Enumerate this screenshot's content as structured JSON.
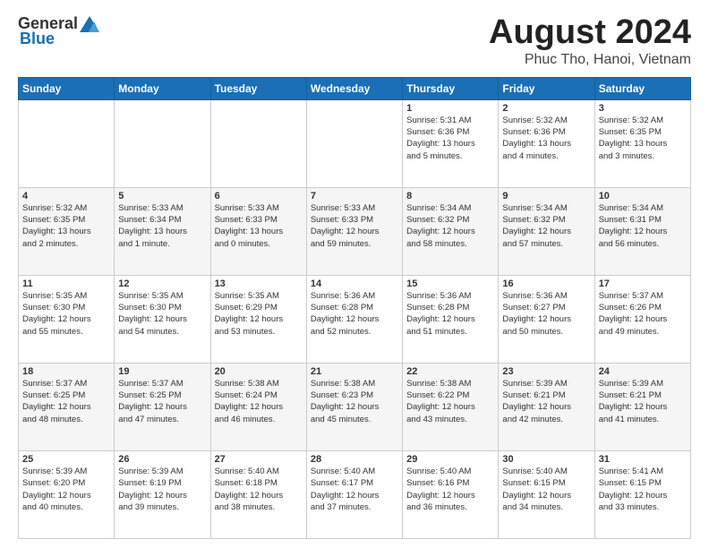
{
  "logo": {
    "general": "General",
    "blue": "Blue"
  },
  "title": {
    "main": "August 2024",
    "sub": "Phuc Tho, Hanoi, Vietnam"
  },
  "headers": [
    "Sunday",
    "Monday",
    "Tuesday",
    "Wednesday",
    "Thursday",
    "Friday",
    "Saturday"
  ],
  "weeks": [
    [
      {
        "day": "",
        "info": ""
      },
      {
        "day": "",
        "info": ""
      },
      {
        "day": "",
        "info": ""
      },
      {
        "day": "",
        "info": ""
      },
      {
        "day": "1",
        "info": "Sunrise: 5:31 AM\nSunset: 6:36 PM\nDaylight: 13 hours\nand 5 minutes."
      },
      {
        "day": "2",
        "info": "Sunrise: 5:32 AM\nSunset: 6:36 PM\nDaylight: 13 hours\nand 4 minutes."
      },
      {
        "day": "3",
        "info": "Sunrise: 5:32 AM\nSunset: 6:35 PM\nDaylight: 13 hours\nand 3 minutes."
      }
    ],
    [
      {
        "day": "4",
        "info": "Sunrise: 5:32 AM\nSunset: 6:35 PM\nDaylight: 13 hours\nand 2 minutes."
      },
      {
        "day": "5",
        "info": "Sunrise: 5:33 AM\nSunset: 6:34 PM\nDaylight: 13 hours\nand 1 minute."
      },
      {
        "day": "6",
        "info": "Sunrise: 5:33 AM\nSunset: 6:33 PM\nDaylight: 13 hours\nand 0 minutes."
      },
      {
        "day": "7",
        "info": "Sunrise: 5:33 AM\nSunset: 6:33 PM\nDaylight: 12 hours\nand 59 minutes."
      },
      {
        "day": "8",
        "info": "Sunrise: 5:34 AM\nSunset: 6:32 PM\nDaylight: 12 hours\nand 58 minutes."
      },
      {
        "day": "9",
        "info": "Sunrise: 5:34 AM\nSunset: 6:32 PM\nDaylight: 12 hours\nand 57 minutes."
      },
      {
        "day": "10",
        "info": "Sunrise: 5:34 AM\nSunset: 6:31 PM\nDaylight: 12 hours\nand 56 minutes."
      }
    ],
    [
      {
        "day": "11",
        "info": "Sunrise: 5:35 AM\nSunset: 6:30 PM\nDaylight: 12 hours\nand 55 minutes."
      },
      {
        "day": "12",
        "info": "Sunrise: 5:35 AM\nSunset: 6:30 PM\nDaylight: 12 hours\nand 54 minutes."
      },
      {
        "day": "13",
        "info": "Sunrise: 5:35 AM\nSunset: 6:29 PM\nDaylight: 12 hours\nand 53 minutes."
      },
      {
        "day": "14",
        "info": "Sunrise: 5:36 AM\nSunset: 6:28 PM\nDaylight: 12 hours\nand 52 minutes."
      },
      {
        "day": "15",
        "info": "Sunrise: 5:36 AM\nSunset: 6:28 PM\nDaylight: 12 hours\nand 51 minutes."
      },
      {
        "day": "16",
        "info": "Sunrise: 5:36 AM\nSunset: 6:27 PM\nDaylight: 12 hours\nand 50 minutes."
      },
      {
        "day": "17",
        "info": "Sunrise: 5:37 AM\nSunset: 6:26 PM\nDaylight: 12 hours\nand 49 minutes."
      }
    ],
    [
      {
        "day": "18",
        "info": "Sunrise: 5:37 AM\nSunset: 6:25 PM\nDaylight: 12 hours\nand 48 minutes."
      },
      {
        "day": "19",
        "info": "Sunrise: 5:37 AM\nSunset: 6:25 PM\nDaylight: 12 hours\nand 47 minutes."
      },
      {
        "day": "20",
        "info": "Sunrise: 5:38 AM\nSunset: 6:24 PM\nDaylight: 12 hours\nand 46 minutes."
      },
      {
        "day": "21",
        "info": "Sunrise: 5:38 AM\nSunset: 6:23 PM\nDaylight: 12 hours\nand 45 minutes."
      },
      {
        "day": "22",
        "info": "Sunrise: 5:38 AM\nSunset: 6:22 PM\nDaylight: 12 hours\nand 43 minutes."
      },
      {
        "day": "23",
        "info": "Sunrise: 5:39 AM\nSunset: 6:21 PM\nDaylight: 12 hours\nand 42 minutes."
      },
      {
        "day": "24",
        "info": "Sunrise: 5:39 AM\nSunset: 6:21 PM\nDaylight: 12 hours\nand 41 minutes."
      }
    ],
    [
      {
        "day": "25",
        "info": "Sunrise: 5:39 AM\nSunset: 6:20 PM\nDaylight: 12 hours\nand 40 minutes."
      },
      {
        "day": "26",
        "info": "Sunrise: 5:39 AM\nSunset: 6:19 PM\nDaylight: 12 hours\nand 39 minutes."
      },
      {
        "day": "27",
        "info": "Sunrise: 5:40 AM\nSunset: 6:18 PM\nDaylight: 12 hours\nand 38 minutes."
      },
      {
        "day": "28",
        "info": "Sunrise: 5:40 AM\nSunset: 6:17 PM\nDaylight: 12 hours\nand 37 minutes."
      },
      {
        "day": "29",
        "info": "Sunrise: 5:40 AM\nSunset: 6:16 PM\nDaylight: 12 hours\nand 36 minutes."
      },
      {
        "day": "30",
        "info": "Sunrise: 5:40 AM\nSunset: 6:15 PM\nDaylight: 12 hours\nand 34 minutes."
      },
      {
        "day": "31",
        "info": "Sunrise: 5:41 AM\nSunset: 6:15 PM\nDaylight: 12 hours\nand 33 minutes."
      }
    ]
  ]
}
